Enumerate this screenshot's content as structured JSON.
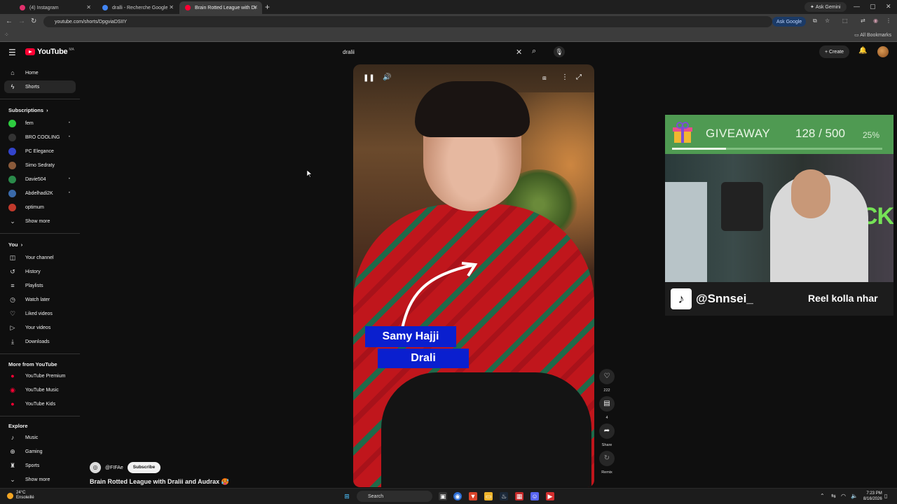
{
  "browser": {
    "tabs": [
      {
        "label": "(4) Instagram",
        "color": "#e1306c"
      },
      {
        "label": "dralli - Recherche Google",
        "color": "#4285f4"
      },
      {
        "label": "Brain Rotted League with Dr",
        "color": "#ff0033"
      }
    ],
    "ask_gemini": "Ask Gemini",
    "url": "youtube.com/shorts/DpgviaDSIIY",
    "ask_google": "Ask Google",
    "all_bookmarks": "All Bookmarks"
  },
  "youtube": {
    "logo_text": "YouTube",
    "country": "MA",
    "search_value": "dralii",
    "create_label": "Create"
  },
  "sidebar": {
    "main": [
      {
        "label": "Home",
        "icon": "home-icon",
        "glyph": "⌂"
      },
      {
        "label": "Shorts",
        "icon": "shorts-icon",
        "glyph": "⚡"
      }
    ],
    "subscriptions_title": "Subscriptions",
    "subscriptions": [
      {
        "label": "fem",
        "color": "#2ecc40",
        "dot": true
      },
      {
        "label": "BRO COOLING",
        "color": "#333",
        "dot": true
      },
      {
        "label": "PC Elegance",
        "color": "#3344cc",
        "dot": false
      },
      {
        "label": "Simo Sedraty",
        "color": "#8a5a3a",
        "dot": false
      },
      {
        "label": "Davie504",
        "color": "#2a8a4a",
        "dot": true
      },
      {
        "label": "Abdelhadi2K",
        "color": "#3a6aaa",
        "dot": true
      },
      {
        "label": "optimum",
        "color": "#c0392b",
        "dot": false
      }
    ],
    "show_more": "Show more",
    "you_title": "You",
    "you": [
      {
        "label": "Your channel",
        "icon": "your-channel-icon",
        "glyph": "◫"
      },
      {
        "label": "History",
        "icon": "history-icon",
        "glyph": "↺"
      },
      {
        "label": "Playlists",
        "icon": "playlists-icon",
        "glyph": "≡"
      },
      {
        "label": "Watch later",
        "icon": "watch-later-icon",
        "glyph": "◷"
      },
      {
        "label": "Liked videos",
        "icon": "liked-videos-icon",
        "glyph": "👍"
      },
      {
        "label": "Your videos",
        "icon": "your-videos-icon",
        "glyph": "▶"
      },
      {
        "label": "Downloads",
        "icon": "downloads-icon",
        "glyph": "⤓"
      }
    ],
    "more_title": "More from YouTube",
    "more": [
      {
        "label": "YouTube Premium"
      },
      {
        "label": "YouTube Music"
      },
      {
        "label": "YouTube Kids"
      }
    ],
    "explore_title": "Explore",
    "explore": [
      {
        "label": "Music",
        "icon": "music-icon",
        "glyph": "♪"
      },
      {
        "label": "Gaming",
        "icon": "gaming-icon",
        "glyph": "⊕"
      },
      {
        "label": "Sports",
        "icon": "sports-icon",
        "glyph": "🏆"
      }
    ],
    "explore_show_more": "Show more"
  },
  "short": {
    "caption_line1": "Samy Hajji",
    "caption_line2": "Drali",
    "likes": "222",
    "comments": "4",
    "share_label": "Share",
    "remix_label": "Remix",
    "channel_handle": "@FIFAe",
    "subscribe_label": "Subscribe",
    "title": "Brain Rotted League with Dralii and Audrax 🥵"
  },
  "overlay": {
    "giveaway_label": "GIVEAWAY",
    "count": "128",
    "total": "500",
    "percent_text": "25%",
    "progress": 0.256,
    "tiktok_handle": "@Snnsei_",
    "message": "Reel kolla nhar",
    "cam_sign": "KICK"
  },
  "taskbar": {
    "temp": "24°C",
    "weather": "Ensoleillé",
    "search_label": "Search",
    "time": "7:23 PM",
    "date": "8/16/2026"
  }
}
